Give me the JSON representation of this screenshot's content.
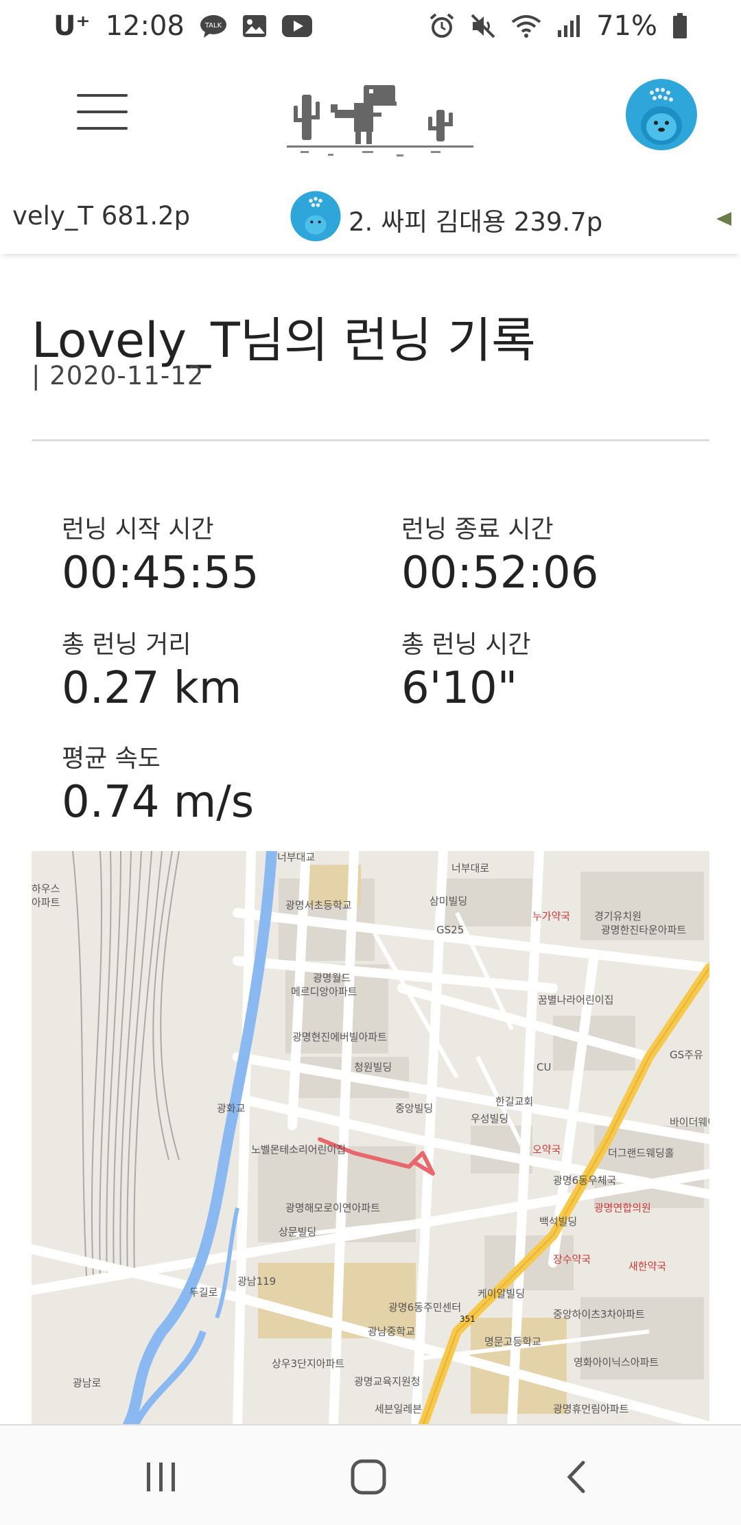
{
  "status": {
    "carrier": "U⁺",
    "time": "12:08",
    "battery": "71%"
  },
  "icons": [
    "talk-icon",
    "gallery-icon",
    "youtube-icon",
    "alarm-icon",
    "mute-icon",
    "wifi-icon",
    "signal-icon",
    "battery-icon",
    "menu-icon",
    "dino-logo-icon",
    "avatar-icon"
  ],
  "colors": {
    "accent": "#2ea6d9",
    "route": "#e8676d",
    "map_bg": "#ece9e2",
    "road_major": "#f6c94c"
  },
  "ticker": {
    "item1": "vely_T 681.2p",
    "item2": "2. 싸피 김대용 239.7p"
  },
  "record": {
    "title": "Lovely_T님의 런닝 기록",
    "date": "| 2020-11-12"
  },
  "stats": {
    "start_label": "런닝 시작 시간",
    "start_value": "00:45:55",
    "end_label": "런닝 종료 시간",
    "end_value": "00:52:06",
    "distance_label": "총 런닝 거리",
    "distance_value": "0.27 km",
    "duration_label": "총 런닝 시간",
    "duration_value": "6'10\"",
    "speed_label": "평균 속도",
    "speed_value": "0.74 m/s"
  },
  "map": {
    "labels": [
      "너부대교",
      "너부대로",
      "삼미빌딩",
      "광명서초등학교",
      "누가약국",
      "경기유치원",
      "광명한진타운아파트",
      "GS25",
      "광명월드",
      "메르디앙아파트",
      "꿈별나라어린이집",
      "광명현진에버빌아파트",
      "CU",
      "GS주유",
      "청원빌딩",
      "중앙빌딩",
      "한길교회",
      "바이더웨이",
      "광화교",
      "우성빌딩",
      "노벨몬테소리어린이집",
      "오약국",
      "더그랜드웨딩홀",
      "광명해모로이연아파트",
      "광명6동우체국",
      "광명연합의원",
      "상문빌딩",
      "백석빌딩",
      "장수약국",
      "새한약국",
      "광남119",
      "두길로",
      "케이알빌딩",
      "광명6동주민센터",
      "중앙하이츠3차아파트",
      "광남중학교",
      "명문고등학교",
      "영화아이닉스아파트",
      "상우3단지아파트",
      "광명교육지원청",
      "세븐일레븐",
      "광명휴먼림아파트",
      "하우스",
      "아파트",
      "광남로",
      "351"
    ]
  },
  "nav": {
    "recent": "recent-apps",
    "home": "home",
    "back": "back"
  }
}
